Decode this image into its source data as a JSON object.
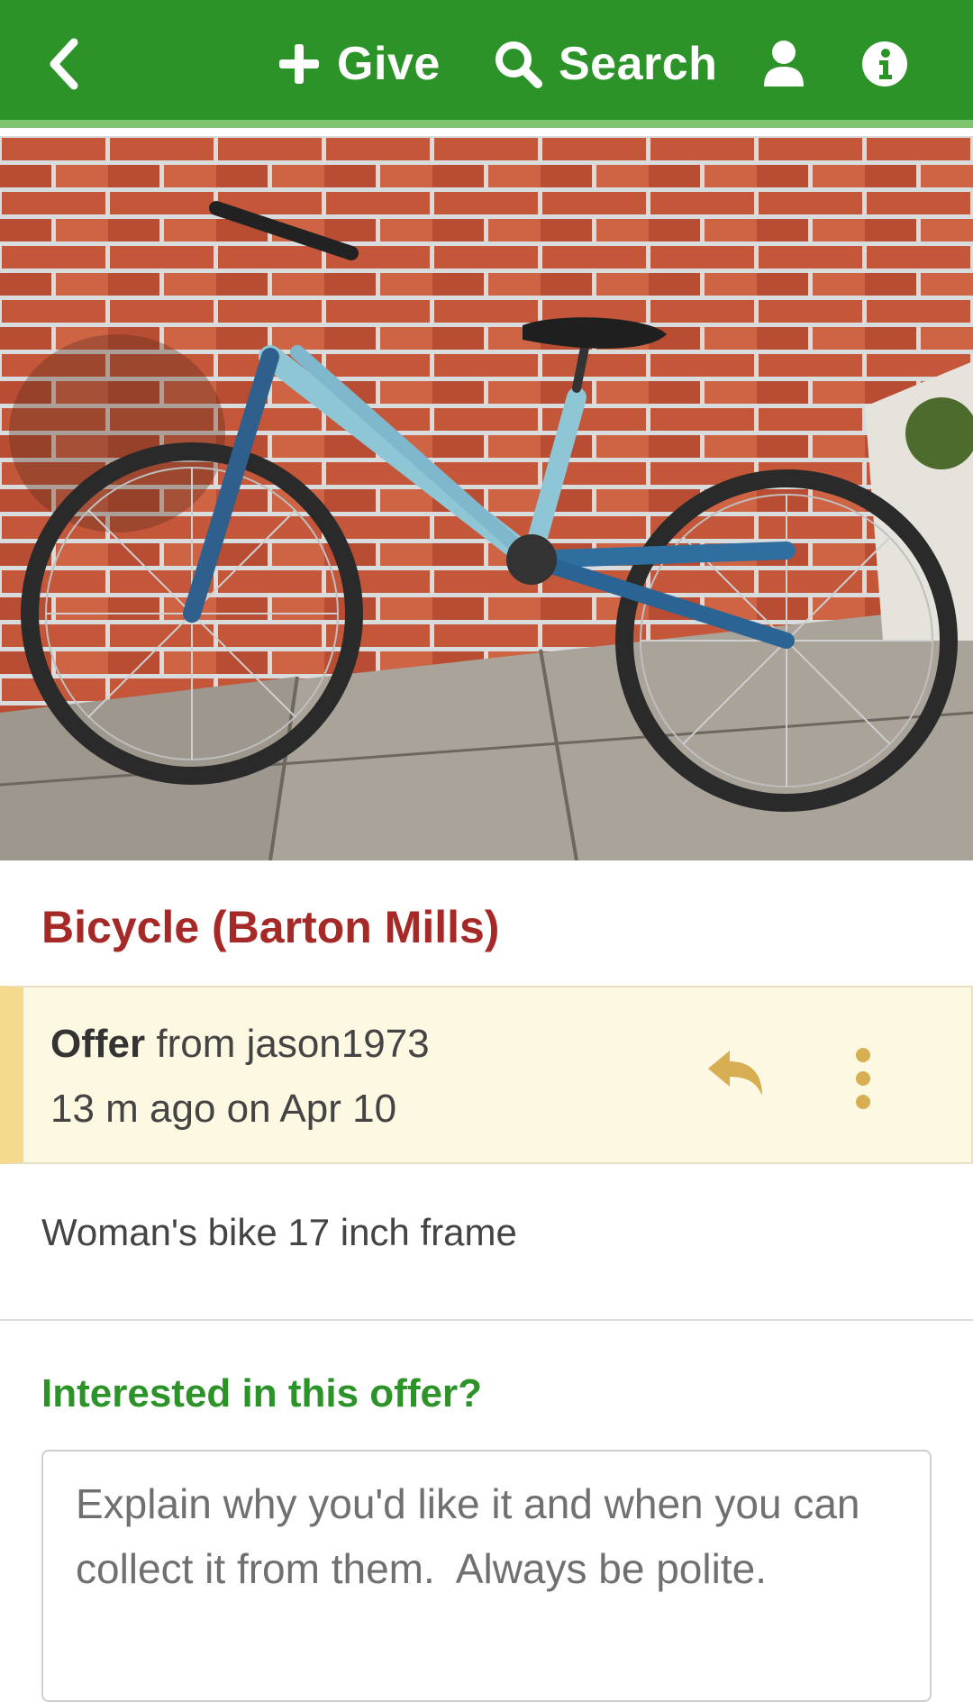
{
  "topbar": {
    "back_icon": "chevron-left-icon",
    "give_label": "Give",
    "give_icon": "plus-icon",
    "search_label": "Search",
    "search_icon": "search-icon",
    "user_icon": "user-icon",
    "info_icon": "info-icon",
    "bg_color": "#2b9327"
  },
  "photo": {
    "subject": "bicycle-photo"
  },
  "post": {
    "title": "Bicycle (Barton Mills)",
    "title_color": "#a52a27",
    "type": "Offer",
    "from_text": "from jason1973",
    "time_text": "13 m ago on Apr 10",
    "reply_icon": "reply-icon",
    "more_icon": "more-vertical-icon",
    "description": "Woman's bike 17 inch frame"
  },
  "reply": {
    "heading": "Interested in this offer?",
    "placeholder": "Explain why you'd like it and when you can collect it from them.  Always be polite."
  }
}
